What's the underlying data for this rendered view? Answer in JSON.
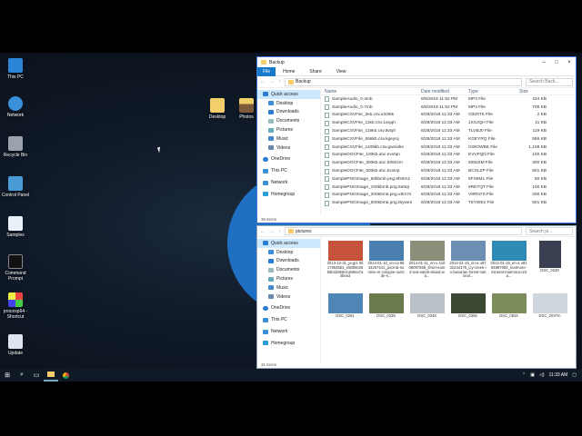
{
  "desktop": {
    "icons": [
      {
        "label": "This PC"
      },
      {
        "label": "Network"
      },
      {
        "label": "Recycle Bin"
      },
      {
        "label": "Control Panel"
      },
      {
        "label": "Samples"
      },
      {
        "label": "Command Prompt"
      },
      {
        "label": "procexp64 - Shortcut"
      },
      {
        "label": "Update"
      },
      {
        "label": "Desktop"
      },
      {
        "label": "Photos"
      }
    ]
  },
  "backup_window": {
    "title": "Backup",
    "ribbon": {
      "file": "File",
      "home": "Home",
      "share": "Share",
      "view": "View"
    },
    "path": "Backup",
    "search_placeholder": "Search Back...",
    "columns": {
      "name": "Name",
      "date": "Date modified",
      "type": "Type",
      "size": "Size"
    },
    "nav": [
      "Quick access",
      "Desktop",
      "Downloads",
      "Documents",
      "Pictures",
      "Music",
      "Videos",
      "OneDrive",
      "This PC",
      "Network",
      "Homegroup"
    ],
    "files": [
      {
        "name": "SampleAudio_0.4mb",
        "date": "6/6/2018 11:52 PM",
        "type": "MP3 File",
        "size": "434 KB"
      },
      {
        "name": "SampleAudio_0.7mb",
        "date": "6/6/2018 11:52 PM",
        "type": "MP3 File",
        "size": "708 KB"
      },
      {
        "name": "SampleCSVFile_2kb.csv.o329tk",
        "date": "8/28/2018 11:33 AM",
        "type": "O329TK File",
        "size": "2 KB"
      },
      {
        "name": "SampleCSVFile_11kb.csv.1xsjqh",
        "date": "8/28/2018 11:33 AM",
        "type": "1XSJQH File",
        "size": "11 KB"
      },
      {
        "name": "SampleCSVFile_119kb.csv.tlvbj0",
        "date": "8/28/2018 11:33 AM",
        "type": "TLVBJ0 File",
        "size": "119 KB"
      },
      {
        "name": "SampleCSVFile_556kb.csv.kgeyrq",
        "date": "8/28/2018 11:33 AM",
        "type": "KGEYRQ File",
        "size": "556 KB"
      },
      {
        "name": "SampleCSVFile_1109kb.csv.gwowbe",
        "date": "8/28/2018 11:33 AM",
        "type": "GWOWBE File",
        "size": "1,109 KB"
      },
      {
        "name": "SampleDOCFile_100kb.doc.evvfqn",
        "date": "8/28/2018 11:33 AM",
        "type": "EVVFQN File",
        "size": "100 KB"
      },
      {
        "name": "SampleDOCFile_300kb.doc.5082zm",
        "date": "8/28/2018 11:33 AM",
        "type": "5082ZM File",
        "size": "300 KB"
      },
      {
        "name": "SampleDOCFile_500kb.doc.bcxlzp",
        "date": "8/28/2018 11:33 AM",
        "type": "BCXLZP File",
        "size": "501 KB"
      },
      {
        "name": "SamplePNGImage_50kbmb.png.6fs6m1",
        "date": "8/28/2018 11:33 AM",
        "type": "6FS6M1 File",
        "size": "50 KB"
      },
      {
        "name": "SamplePNGImage_100kbmb.png.6ettqt",
        "date": "8/28/2018 11:33 AM",
        "type": "6RETQT File",
        "size": "100 KB"
      },
      {
        "name": "SamplePNGImage_200kbmb.png.v8rn7s",
        "date": "8/28/2018 11:33 AM",
        "type": "V8RN7S File",
        "size": "200 KB"
      },
      {
        "name": "SamplePNGImage_500kbmb.png.t5ywe2",
        "date": "8/28/2018 11:33 AM",
        "type": "T5YWE2 File",
        "size": "501 KB"
      }
    ],
    "status": "36 items"
  },
  "pictures_window": {
    "path": "pictures",
    "search_placeholder": "Search pi...",
    "nav": [
      "Quick access",
      "Desktop",
      "Downloads",
      "Documents",
      "Pictures",
      "Music",
      "Videos",
      "OneDrive",
      "This PC",
      "Network",
      "Homegroup"
    ],
    "thumbs": [
      {
        "label": "2013-12-31_ja-jp1 06179535b4_e5808c65b6b1b5b6e1a59ea7a4bea3",
        "color": "#c7543a"
      },
      {
        "label": "2014-01-10_en-ca 8643257441_pool-at-sunrise-in-cologne-outside-s...",
        "color": "#4a7fb0"
      },
      {
        "label": "2014-01-11_en-u s1008097559_short-eared-owl-sarah-island-wa...",
        "color": "#8a8f7a"
      },
      {
        "label": "2014-01-15_en-a u9732244175_icy-creek-in-bavarian-forest-national...",
        "color": "#6d8fb3"
      },
      {
        "label": "2014-01-16_en-a u9194987084_marmore-mineral-marmora-onta...",
        "color": "#2f8bb5"
      },
      {
        "label": "DSC_0249",
        "color": "#3a3f52",
        "tall": true
      },
      {
        "label": "DSC_0261",
        "color": "#4f86b8"
      },
      {
        "label": "DSC_0339",
        "color": "#6a7b4e"
      },
      {
        "label": "DSC_0348",
        "color": "#b9c0c8"
      },
      {
        "label": "DSC_0358",
        "color": "#3c4a35"
      },
      {
        "label": "DSC_0834",
        "color": "#7c8c5a"
      },
      {
        "label": "DSC_2037m",
        "color": "#cfd6dd"
      }
    ],
    "status": "31 items"
  },
  "taskbar": {
    "time": "11:33 AM"
  },
  "colors": {
    "accent": "#1979ca",
    "selection": "#cce8ff"
  }
}
